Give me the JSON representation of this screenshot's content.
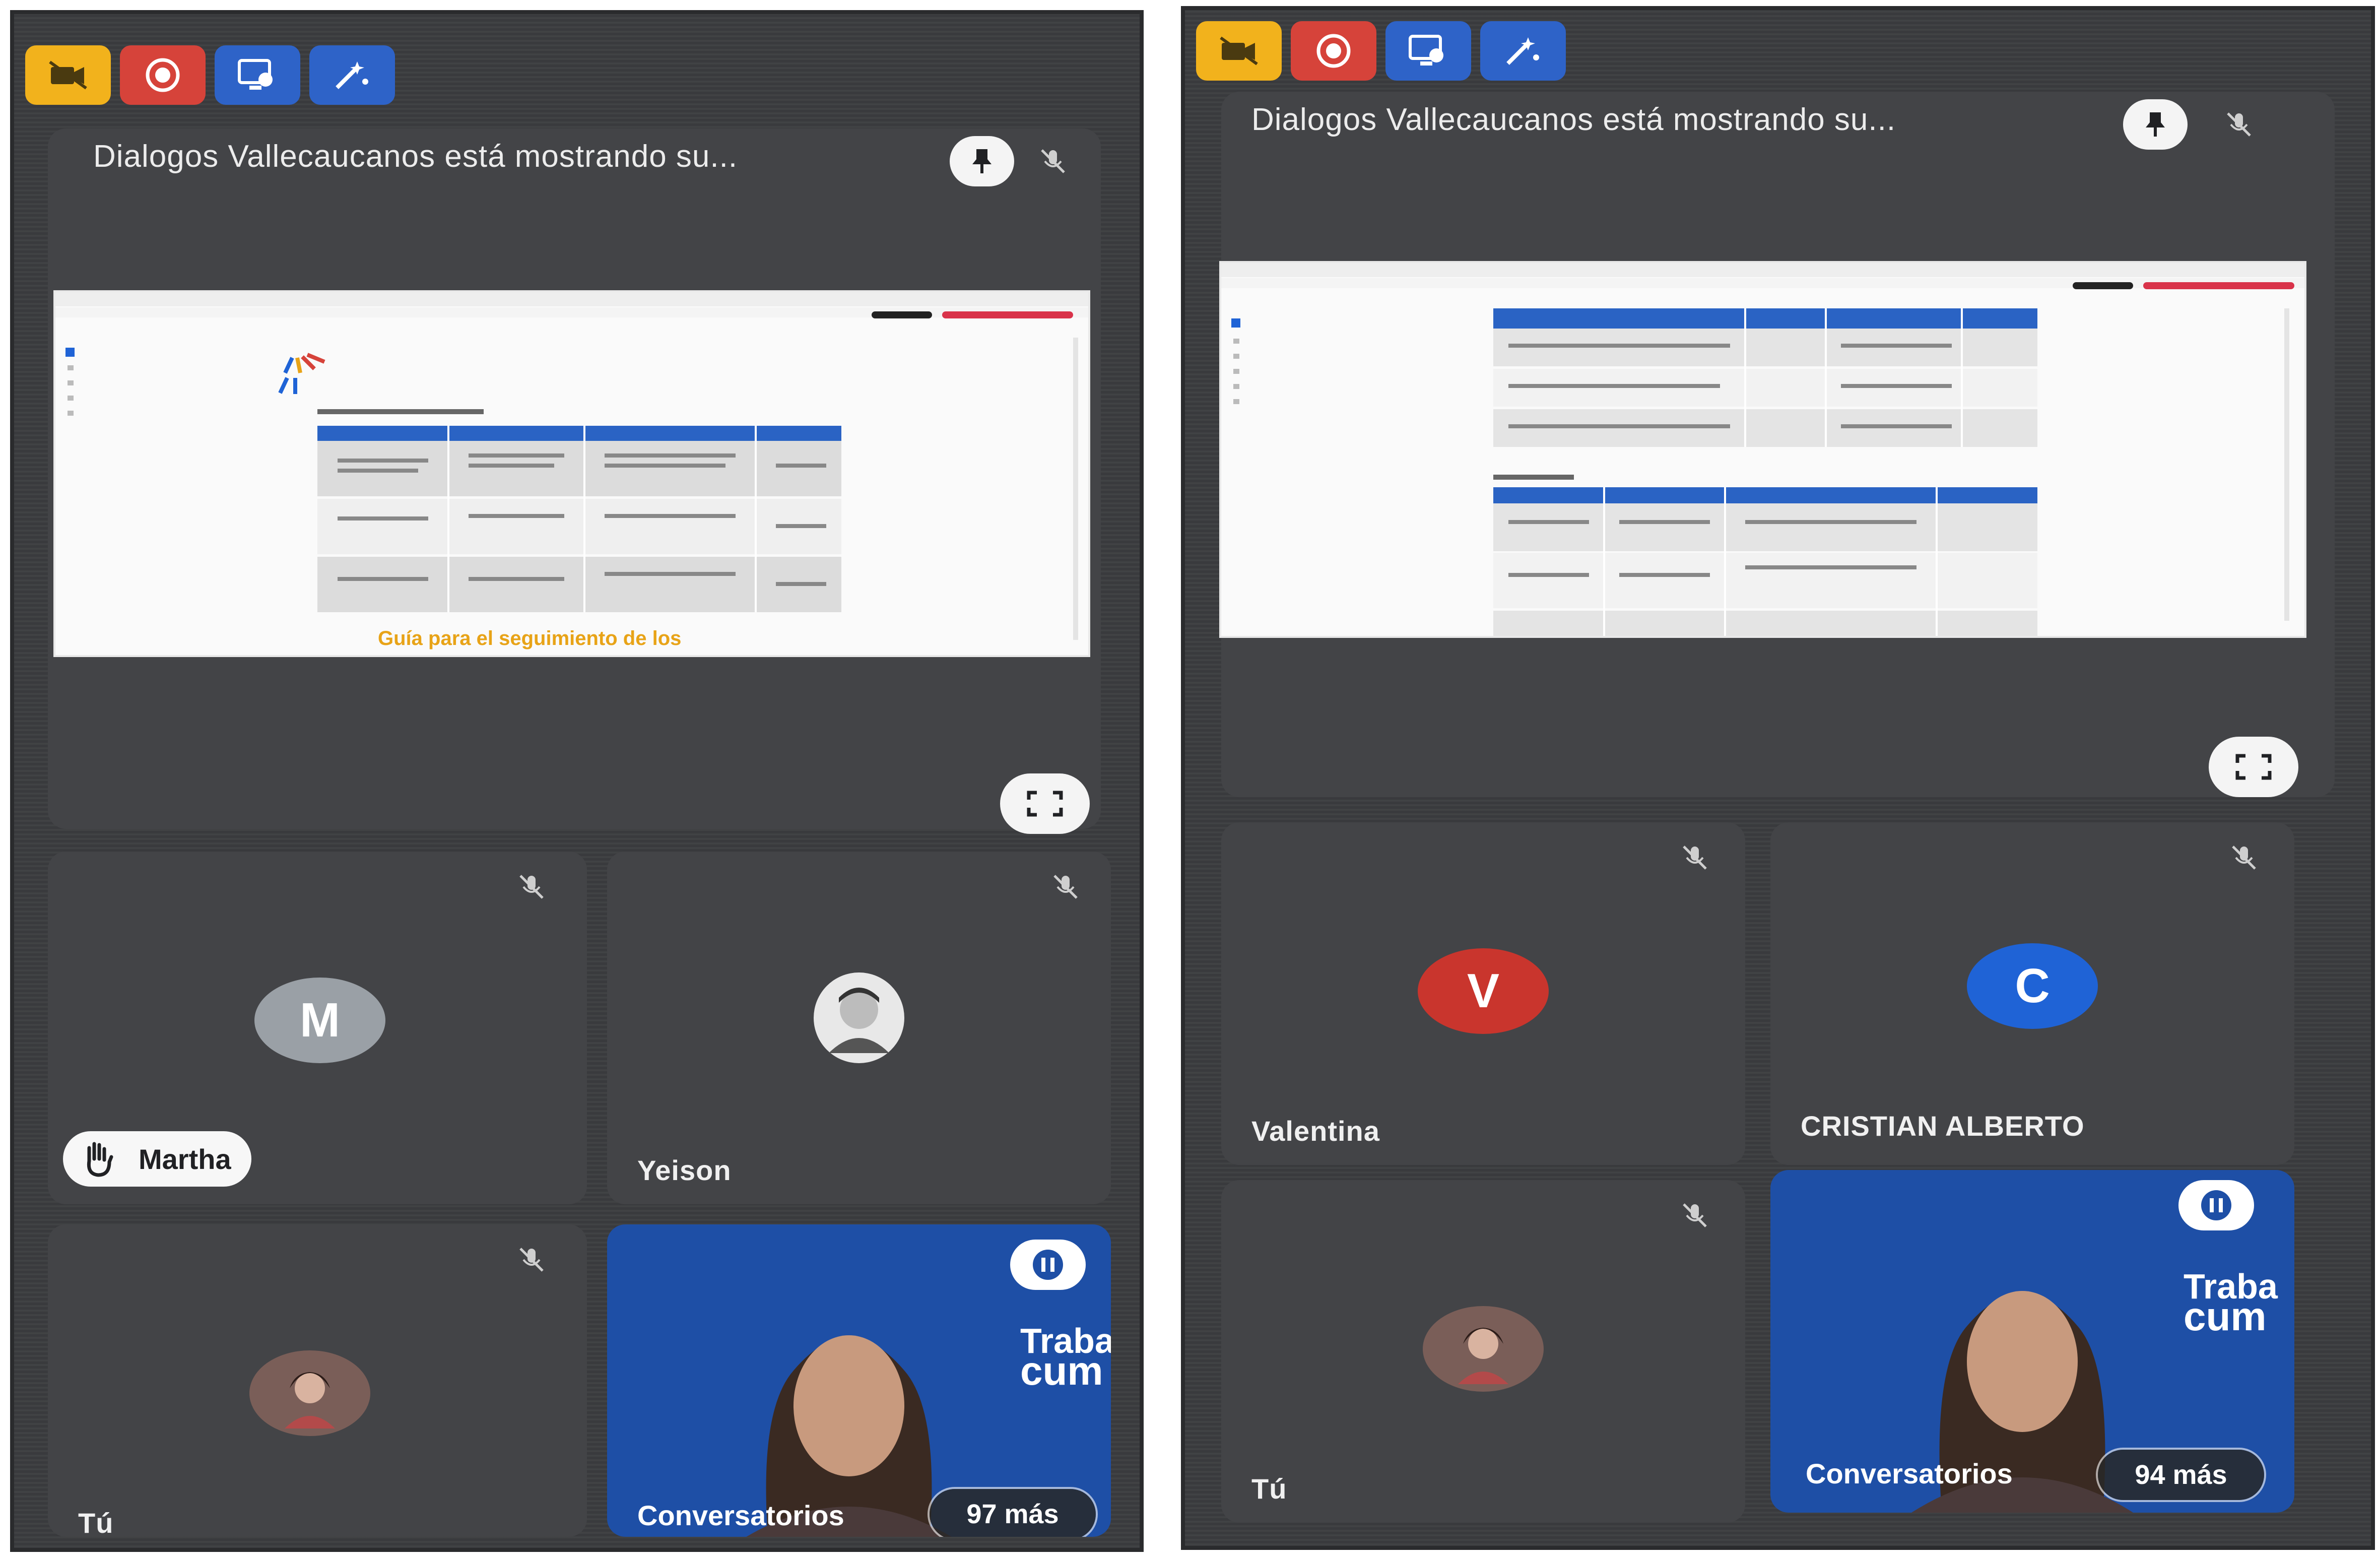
{
  "colors": {
    "phone_bg": "#3c3d40",
    "tile_bg": "#434447",
    "record_red": "#d6433a",
    "control_blue": "#2e63c8",
    "control_yellow": "#f2b21c",
    "avatar_m": "#9aa0a6",
    "avatar_v": "#c9352d",
    "avatar_c": "#1f63d6",
    "video_bg": "#1e4fa6"
  },
  "icons": [
    "camera-off-icon",
    "record-icon",
    "present-icon",
    "effects-icon",
    "pin-icon",
    "mic-off-icon",
    "expand-icon",
    "raised-hand-icon"
  ],
  "left": {
    "share_title": "Dialogos Vallecaucanos está mostrando su...",
    "slide_caption": "Guía para el seguimiento de los",
    "participants": [
      {
        "name": "Martha",
        "initial": "M",
        "hand_raised": true
      },
      {
        "name": "Yeison",
        "initial": ""
      },
      {
        "name": "Tú",
        "initial": ""
      },
      {
        "name": "Conversatorios",
        "initial": ""
      }
    ],
    "more_count": "97 más",
    "video_brand_line1": "Traba",
    "video_brand_line2": "cum"
  },
  "right": {
    "share_title": "Dialogos Vallecaucanos está mostrando su...",
    "participants": [
      {
        "name": "Valentina",
        "initial": "V"
      },
      {
        "name": "CRISTIAN ALBERTO",
        "initial": "C"
      },
      {
        "name": "Tú",
        "initial": ""
      },
      {
        "name": "Conversatorios",
        "initial": ""
      }
    ],
    "more_count": "94 más",
    "video_brand_line1": "Traba",
    "video_brand_line2": "cum"
  }
}
